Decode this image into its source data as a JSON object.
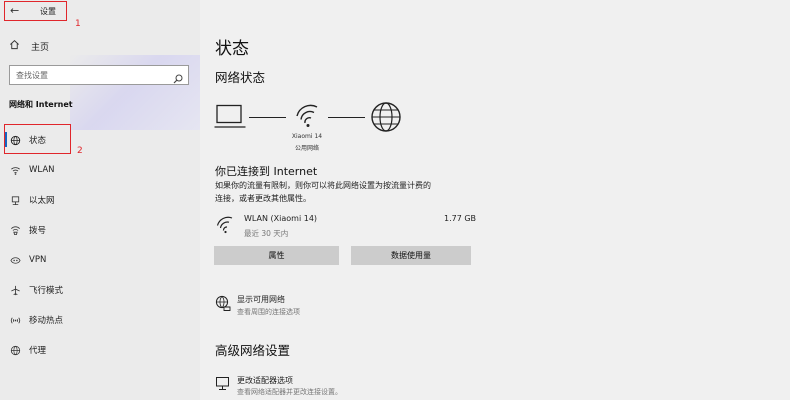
{
  "window": {
    "back_glyph": "←",
    "title": "设置"
  },
  "annotations": {
    "one": "1",
    "two": "2",
    "color": "#e0262b"
  },
  "sidebar": {
    "home_label": "主页",
    "search_placeholder": "查找设置",
    "section_heading": "网络和 Internet",
    "items": [
      {
        "label": "状态",
        "icon": "status-globe-icon",
        "active": true
      },
      {
        "label": "WLAN",
        "icon": "wifi-icon"
      },
      {
        "label": "以太网",
        "icon": "ethernet-icon"
      },
      {
        "label": "拨号",
        "icon": "dialup-icon"
      },
      {
        "label": "VPN",
        "icon": "vpn-icon"
      },
      {
        "label": "飞行模式",
        "icon": "airplane-icon"
      },
      {
        "label": "移动热点",
        "icon": "hotspot-icon"
      },
      {
        "label": "代理",
        "icon": "proxy-globe-icon"
      }
    ],
    "accent_color": "#1565c0"
  },
  "main": {
    "page_title": "状态",
    "network_status_heading": "网络状态",
    "network_name": "Xiaomi 14",
    "network_type": "公用网络",
    "connected_heading": "你已连接到 Internet",
    "connected_desc_line1": "如果你的流量有限制，则你可以将此网络设置为按流量计费的",
    "connected_desc_line2": "连接，或者更改其他属性。",
    "connection": {
      "name": "WLAN (Xiaomi 14)",
      "period": "最近 30 天内",
      "usage": "1.77 GB"
    },
    "buttons": {
      "properties": "属性",
      "data_usage": "数据使用量"
    },
    "show_networks": {
      "title": "显示可用网络",
      "subtitle": "查看周围的连接选项"
    },
    "advanced_heading": "高级网络设置",
    "change_adapter": {
      "title": "更改适配器选项",
      "subtitle": "查看网络适配器并更改连接设置。"
    }
  }
}
